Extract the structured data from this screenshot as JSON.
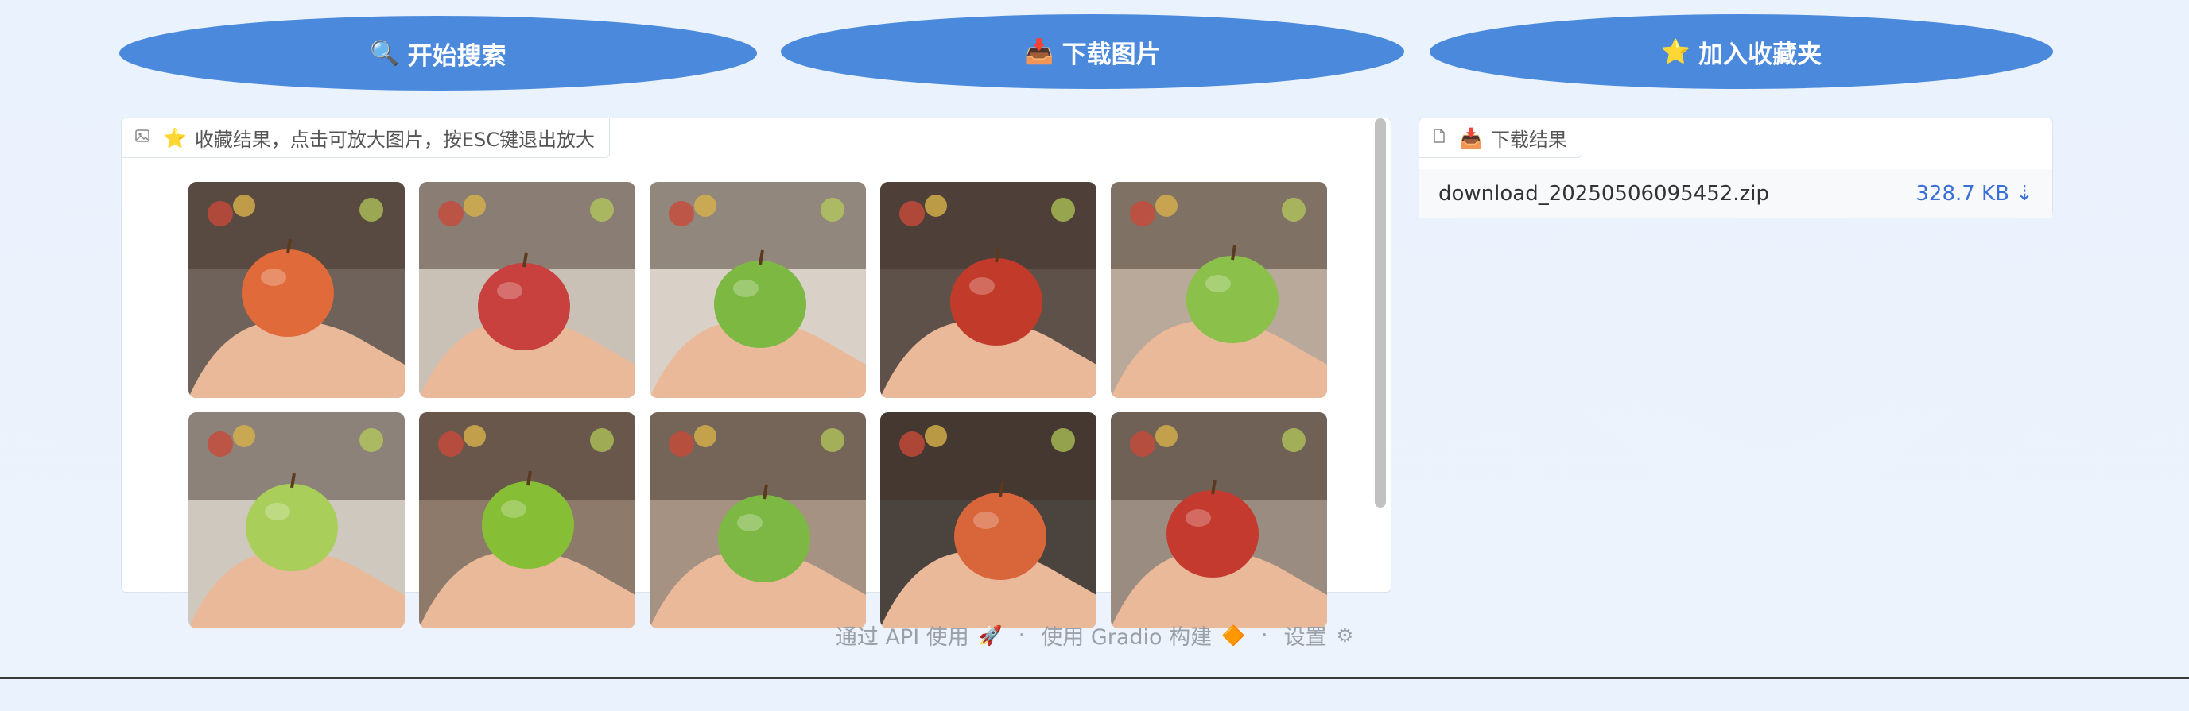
{
  "buttons": {
    "search": {
      "icon": "🔍",
      "label": "开始搜索"
    },
    "download": {
      "icon": "📥",
      "label": "下载图片"
    },
    "favorite": {
      "icon": "⭐",
      "label": "加入收藏夹"
    }
  },
  "gallery_panel": {
    "label": "收藏结果，点击可放大图片，按ESC键退出放大",
    "icon_emoji": "⭐",
    "images": [
      {
        "name": "apple-image",
        "apple": "#e06a3a",
        "bg": "#6f625a"
      },
      {
        "name": "apple-image",
        "apple": "#c8413e",
        "bg": "#c9c0b6"
      },
      {
        "name": "apple-image",
        "apple": "#7db843",
        "bg": "#d9d1c7"
      },
      {
        "name": "apple-image",
        "apple": "#c23b2a",
        "bg": "#5e5149"
      },
      {
        "name": "apple-image",
        "apple": "#8bc04a",
        "bg": "#b9a99b"
      },
      {
        "name": "apple-image",
        "apple": "#a9cf5a",
        "bg": "#cfc8bf"
      },
      {
        "name": "apple-image",
        "apple": "#86bf36",
        "bg": "#8d7a6b"
      },
      {
        "name": "apple-image",
        "apple": "#7cb843",
        "bg": "#a59283"
      },
      {
        "name": "apple-image",
        "apple": "#d9653a",
        "bg": "#4b433d"
      },
      {
        "name": "apple-image",
        "apple": "#c43a2e",
        "bg": "#9a8c80"
      }
    ]
  },
  "download_panel": {
    "label": "下载结果",
    "icon_emoji": "📥",
    "file_name": "download_20250506095452.zip",
    "file_size": "328.7 KB ⇣"
  },
  "footer": {
    "api": "通过 API 使用",
    "api_emoji": "🚀",
    "gradio": "使用 Gradio 构建",
    "gradio_emoji": "🔶",
    "settings": "设置",
    "settings_emoji": "⚙",
    "separator": "·"
  },
  "colors": {
    "button_bg": "#4a89dc",
    "link_blue": "#3a6fd8"
  }
}
